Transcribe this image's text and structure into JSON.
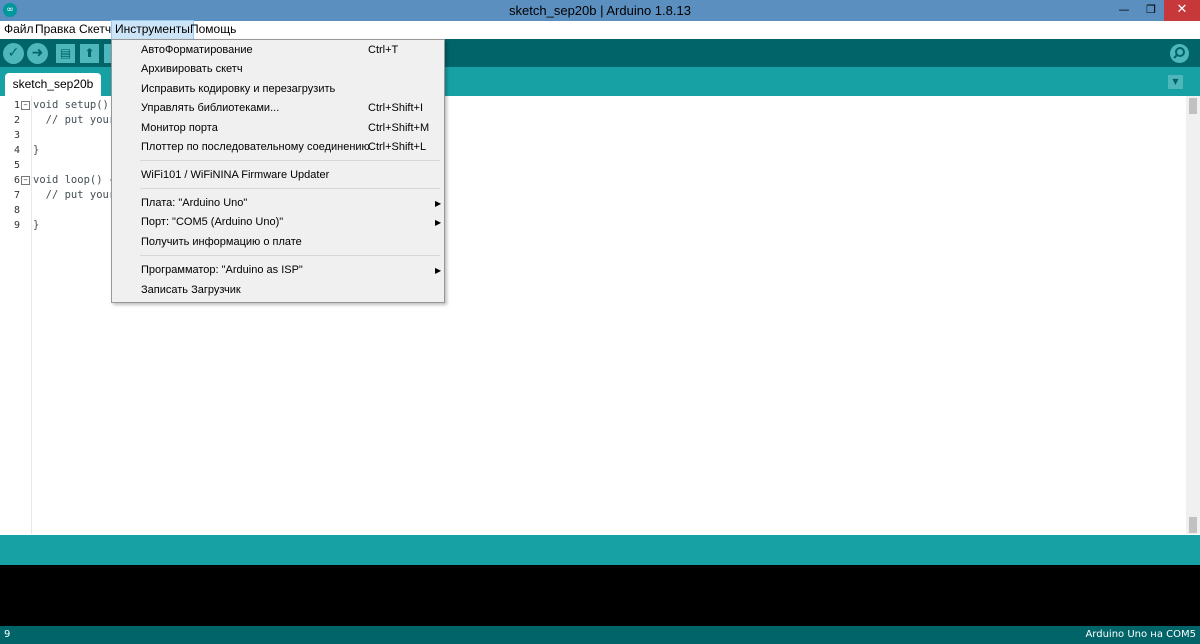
{
  "window": {
    "title": "sketch_sep20b | Arduino 1.8.13",
    "app_icon": "∞",
    "minimize": "—",
    "maximize": "❐",
    "close": "✕"
  },
  "menubar": {
    "items": [
      {
        "label": "Файл"
      },
      {
        "label": "Правка"
      },
      {
        "label": "Скетч"
      },
      {
        "label": "Инструменты",
        "active": true
      },
      {
        "label": "Помощь"
      }
    ]
  },
  "toolbar": {
    "buttons": [
      {
        "name": "verify",
        "icon": "check-icon",
        "glyph": "✓"
      },
      {
        "name": "upload",
        "icon": "arrow-right-icon",
        "glyph": "➜"
      },
      {
        "name": "new",
        "icon": "new-file-icon",
        "glyph": "▤"
      },
      {
        "name": "open",
        "icon": "open-arrow-up-icon",
        "glyph": "⬆"
      },
      {
        "name": "save",
        "icon": "save-arrow-down-icon",
        "glyph": "⬇"
      }
    ],
    "serial_monitor_icon": "magnifier-icon"
  },
  "tabs": [
    {
      "label": "sketch_sep20b",
      "active": true
    }
  ],
  "editor": {
    "lines": [
      {
        "n": "1",
        "fold": "−",
        "text": "void setup() {"
      },
      {
        "n": "2",
        "text": "  // put your"
      },
      {
        "n": "3",
        "text": ""
      },
      {
        "n": "4",
        "text": "}"
      },
      {
        "n": "5",
        "text": ""
      },
      {
        "n": "6",
        "fold": "−",
        "text": "void loop() {"
      },
      {
        "n": "7",
        "text": "  // put your"
      },
      {
        "n": "8",
        "text": ""
      },
      {
        "n": "9",
        "text": "}"
      }
    ]
  },
  "tools_menu": {
    "items": [
      {
        "label": "АвтоФорматирование",
        "shortcut": "Ctrl+T"
      },
      {
        "label": "Архивировать скетч"
      },
      {
        "label": "Исправить кодировку и перезагрузить"
      },
      {
        "label": "Управлять библиотеками...",
        "shortcut": "Ctrl+Shift+I"
      },
      {
        "label": "Монитор порта",
        "shortcut": "Ctrl+Shift+M"
      },
      {
        "label": "Плоттер по последовательному соединению",
        "shortcut": "Ctrl+Shift+L"
      },
      {
        "label": "WiFi101 / WiFiNINA Firmware Updater"
      },
      {
        "label": "Плата: \"Arduino Uno\"",
        "submenu": true
      },
      {
        "label": "Порт: \"COM5 (Arduino Uno)\"",
        "submenu": true
      },
      {
        "label": "Получить информацию о плате"
      },
      {
        "label": "Программатор: \"Arduino as ISP\"",
        "submenu": true
      },
      {
        "label": "Записать Загрузчик"
      }
    ]
  },
  "statusbar": {
    "line": "9",
    "board": "Arduino Uno на COM5"
  },
  "colors": {
    "titlebar": "#5b8fbf",
    "toolbar": "#006468",
    "teal": "#17a1a5",
    "console": "#000000"
  }
}
